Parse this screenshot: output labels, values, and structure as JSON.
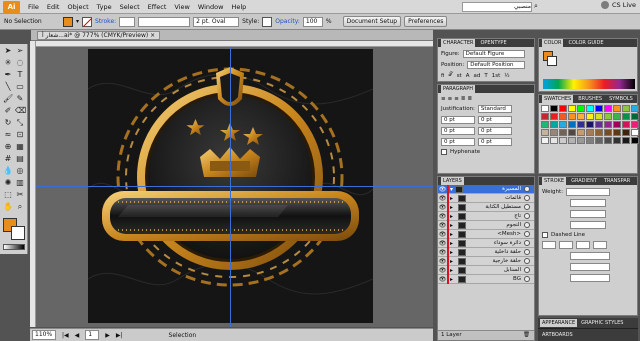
{
  "menubar": {
    "app_logo": "Ai",
    "items": [
      "File",
      "Edit",
      "Object",
      "Type",
      "Select",
      "Effect",
      "View",
      "Window",
      "Help"
    ],
    "search_text": "منصبي",
    "cs_live": "CS Live"
  },
  "control_bar": {
    "selection_label": "No Selection",
    "stroke_label": "Stroke:",
    "brush_value": "2 pt. Oval",
    "style_label": "Style:",
    "opacity_label": "Opacity:",
    "opacity_value": "100",
    "opacity_unit": "%",
    "document_setup": "Document Setup",
    "preferences": "Preferences"
  },
  "document": {
    "tab_title": "شعار أ...ai* @ 777% (CMYK/Preview)"
  },
  "status": {
    "zoom": "110%",
    "page": "1",
    "mode": "Selection"
  },
  "character_panel": {
    "tabs": [
      "CHARACTER",
      "OPENTYPE"
    ],
    "figure_label": "Figure:",
    "figure_value": "Default Figure",
    "position_label": "Position:",
    "position_value": "Default Position"
  },
  "paragraph_panel": {
    "title": "PARAGRAPH",
    "justification_label": "Justification:",
    "justification_value": "Standard",
    "indents": [
      "0 pt",
      "0 pt",
      "0 pt",
      "0 pt",
      "0 pt",
      "0 pt"
    ],
    "hyphenate": "Hyphenate"
  },
  "color_panel": {
    "tabs": [
      "COLOR",
      "COLOR GUIDE"
    ]
  },
  "swatches_panel": {
    "tabs": [
      "SWATCHES",
      "BRUSHES",
      "SYMBOLS"
    ],
    "colors": [
      "#ffffff",
      "#000000",
      "#ff0000",
      "#ffff00",
      "#00ff00",
      "#00ffff",
      "#0000ff",
      "#ff00ff",
      "#f7931e",
      "#8cc63f",
      "#29abe2",
      "#c1272d",
      "#ed1c24",
      "#f15a24",
      "#f7931e",
      "#fbb03b",
      "#fcee21",
      "#d9e021",
      "#8cc63f",
      "#39b54a",
      "#009245",
      "#006837",
      "#22b573",
      "#00a99d",
      "#29abe2",
      "#0071bc",
      "#2e3192",
      "#1b1464",
      "#662d91",
      "#93278f",
      "#9e005d",
      "#d4145a",
      "#ed1e79",
      "#c7b299",
      "#998675",
      "#736357",
      "#534741",
      "#c69c6d",
      "#a67c52",
      "#8c6239",
      "#754c24",
      "#603813",
      "#42210b",
      "#ffffff",
      "#f2f2f2",
      "#e6e6e6",
      "#cccccc",
      "#b3b3b3",
      "#999999",
      "#808080",
      "#666666",
      "#4d4d4d",
      "#333333",
      "#1a1a1a",
      "#000000"
    ]
  },
  "stroke_panel": {
    "tabs": [
      "STROKE",
      "GRADIENT",
      "TRANSPAR"
    ],
    "weight_label": "Weight:",
    "dashed_line": "Dashed Line"
  },
  "layers_panel": {
    "title": "LAYERS",
    "layers": [
      "المسيرة",
      "قائمات",
      "مستطيل الكتابة",
      "تاج",
      "النجوم",
      "<Mesh>",
      "دائرة سوداء",
      "حلقة داخلية",
      "حلقة خارجية",
      "السنابل",
      "BG"
    ],
    "footer": "1 Layer"
  },
  "bottom_tabs": {
    "appearance": "APPEARANCE",
    "graphic_styles": "GRAPHIC STYLES",
    "artboards": "ARTBOARDS"
  },
  "colors": {
    "accent_orange": "#e88d1c",
    "gold": "#d89a2b",
    "selection_blue": "#3a6fd8",
    "artboard": "#111111"
  }
}
